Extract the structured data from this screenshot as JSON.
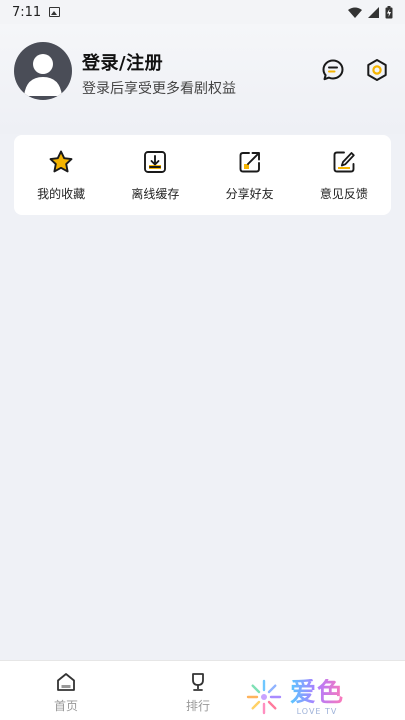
{
  "status_bar": {
    "time": "7:11"
  },
  "profile": {
    "title": "登录/注册",
    "subtitle": "登录后享受更多看剧权益"
  },
  "quick_actions": [
    {
      "label": "我的收藏",
      "icon": "star-icon"
    },
    {
      "label": "离线缓存",
      "icon": "download-icon"
    },
    {
      "label": "分享好友",
      "icon": "share-icon"
    },
    {
      "label": "意见反馈",
      "icon": "feedback-icon"
    }
  ],
  "bottom_nav": [
    {
      "label": "首页",
      "icon": "home-icon"
    },
    {
      "label": "排行",
      "icon": "trophy-icon"
    }
  ],
  "watermark": {
    "title": "爱色",
    "subtitle": "LOVE TV"
  },
  "colors": {
    "accent": "#f5b400",
    "background": "#eff1f6",
    "card": "#ffffff",
    "avatar": "#4a4d57"
  }
}
